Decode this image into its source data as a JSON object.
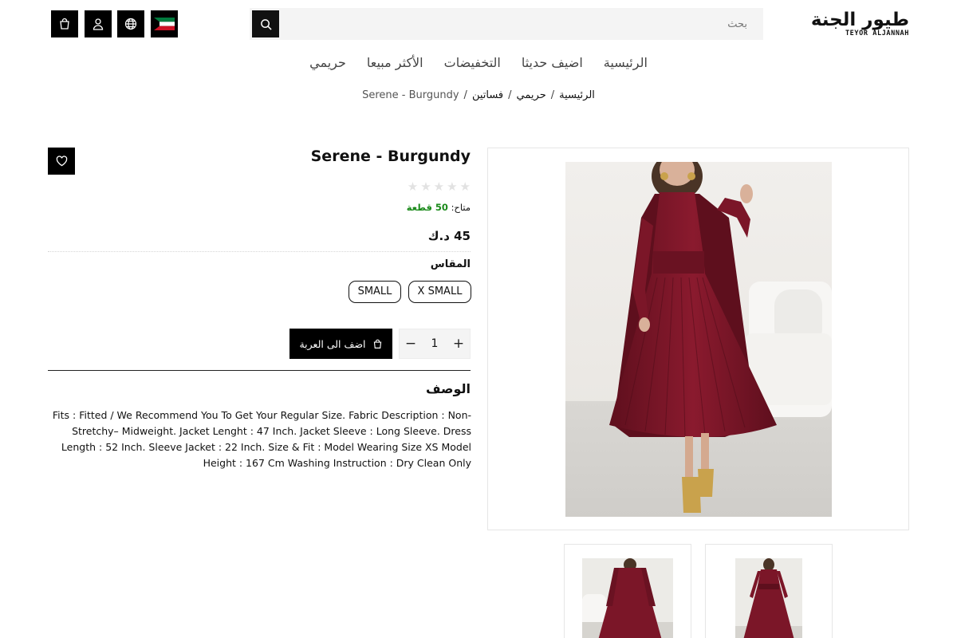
{
  "header": {
    "logo_ar": "طيور الجنة",
    "logo_en": "TEYOR ALJANNAH",
    "search_placeholder": "بحث",
    "icons": [
      "cart-icon",
      "user-icon",
      "globe-icon",
      "kuwait-flag-icon",
      "search-icon"
    ]
  },
  "nav": {
    "items": [
      {
        "label": "الرئيسية"
      },
      {
        "label": "اضيف حديثا"
      },
      {
        "label": "التخفيضات"
      },
      {
        "label": "الأكثر مبيعا"
      },
      {
        "label": "حريمي"
      }
    ]
  },
  "breadcrumb": {
    "items": [
      "الرئيسية",
      "حريمي",
      "فساتين"
    ],
    "separator": "/",
    "current": "Serene - Burgundy"
  },
  "product": {
    "title": "Serene - Burgundy",
    "rating_stars": 0,
    "rating_max": 5,
    "stock_label": "متاح:",
    "stock_value": "50 قطعة",
    "price": "45 د.ك",
    "size_label": "المقاس",
    "sizes": [
      "X SMALL",
      "SMALL"
    ],
    "quantity": "1",
    "qty_minus": "−",
    "qty_plus": "+",
    "add_to_cart": "اضف الى العربة",
    "description_title": "الوصف",
    "description": "Fits : Fitted / We Recommend You To Get Your Regular Size. Fabric Description : Non-Stretchy– Midweight. Jacket Lenght : 47 Inch. Jacket Sleeve : Long Sleeve. Dress Length : 52 Inch. Sleeve Jacket : 22 Inch. Size & Fit : Model Wearing Size XS Model Height : 167 Cm Washing Instruction : Dry Clean Only"
  },
  "colors": {
    "accent": "#000000",
    "in_stock": "#1a8a1a",
    "dress": "#7b1628",
    "background_soft": "#f4f4f4"
  }
}
